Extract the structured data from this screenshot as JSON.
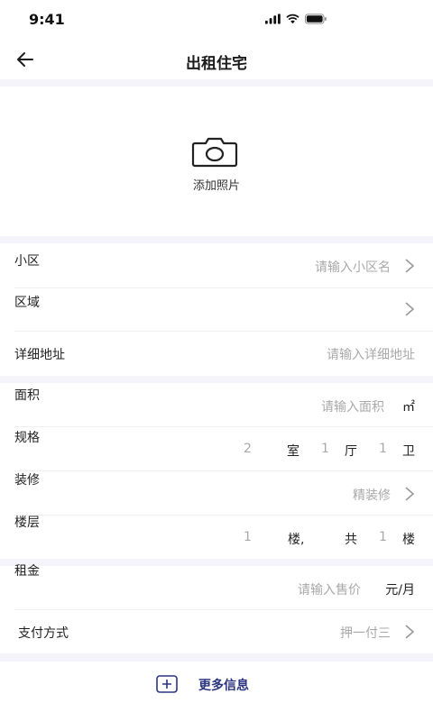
{
  "status_bar": {
    "time": "9:41"
  },
  "nav": {
    "title": "出租住宅"
  },
  "photo": {
    "label": "添加照片"
  },
  "form": {
    "community": {
      "label": "小区",
      "placeholder": "请输入小区名"
    },
    "region": {
      "label": "区域"
    },
    "address": {
      "label": "详细地址",
      "placeholder": "请输入详细地址"
    },
    "area": {
      "label": "面积",
      "placeholder": "请输入面积",
      "unit": "㎡"
    },
    "layout": {
      "label": "规格",
      "rooms": "2",
      "rooms_unit": "室",
      "halls": "1",
      "halls_unit": "厅",
      "baths": "1",
      "baths_unit": "卫"
    },
    "decoration": {
      "label": "装修",
      "value": "精装修"
    },
    "floor": {
      "label": "楼层",
      "floor_value": "1",
      "floor_unit": "楼,",
      "total_prefix": "共",
      "total_value": "1",
      "total_unit": "楼"
    },
    "rent": {
      "label": "租金",
      "placeholder": "请输入售价",
      "unit": "元/月"
    },
    "payment": {
      "label": "支付方式",
      "value": "押一付三"
    }
  },
  "more": {
    "label": "更多信息"
  }
}
